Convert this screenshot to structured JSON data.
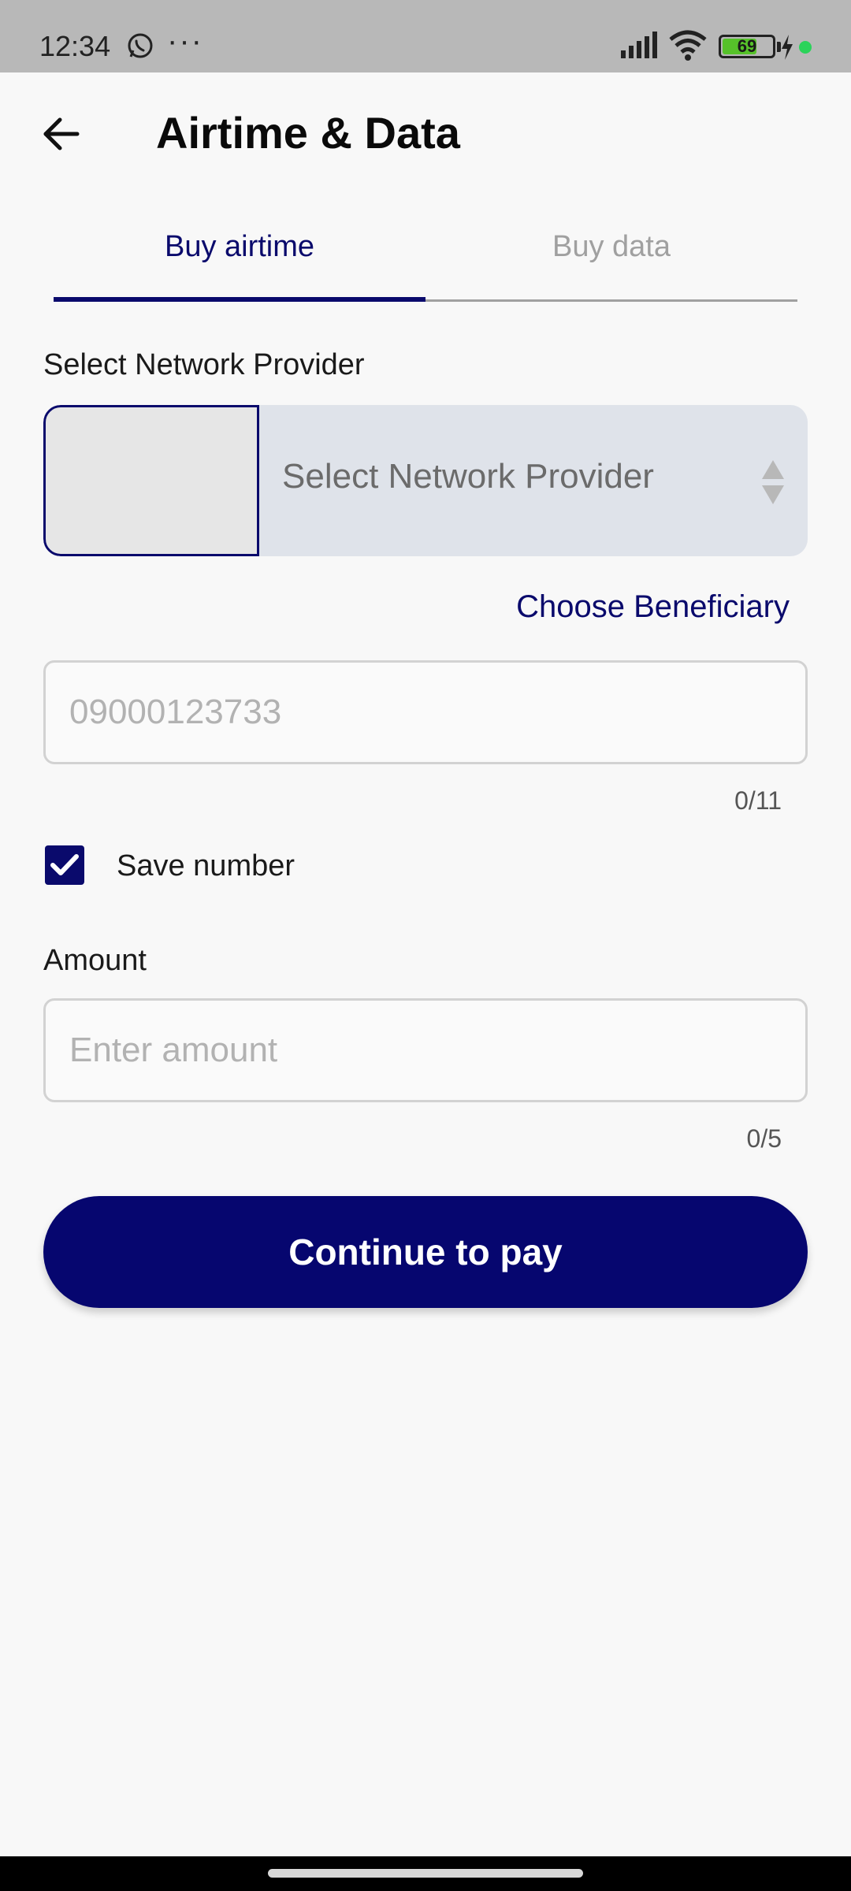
{
  "status_bar": {
    "time": "12:34",
    "dots": "···",
    "battery_level": 69,
    "battery_label": "69",
    "icons": [
      "whatsapp-icon",
      "signal-icon",
      "wifi-icon",
      "battery-icon",
      "bolt-icon"
    ],
    "battery_color": "#56c22a",
    "dot_color": "#2bd35a"
  },
  "header": {
    "title": "Airtime & Data",
    "back_icon": "arrow-left-icon"
  },
  "tabs": [
    {
      "label": "Buy airtime",
      "active": true
    },
    {
      "label": "Buy data",
      "active": false
    }
  ],
  "network": {
    "label": "Select Network Provider",
    "placeholder": "Select Network Provider"
  },
  "beneficiary": {
    "link_label": "Choose Beneficiary"
  },
  "phone": {
    "placeholder": "09000123733",
    "value": "",
    "counter": "0/11"
  },
  "save_number": {
    "label": "Save number",
    "checked": true
  },
  "amount": {
    "label": "Amount",
    "placeholder": "Enter amount",
    "value": "",
    "counter": "0/5"
  },
  "continue_button": {
    "label": "Continue to pay"
  },
  "colors": {
    "primary": "#06066f",
    "background": "#f8f8f8",
    "select_background": "#dfe3ea"
  }
}
